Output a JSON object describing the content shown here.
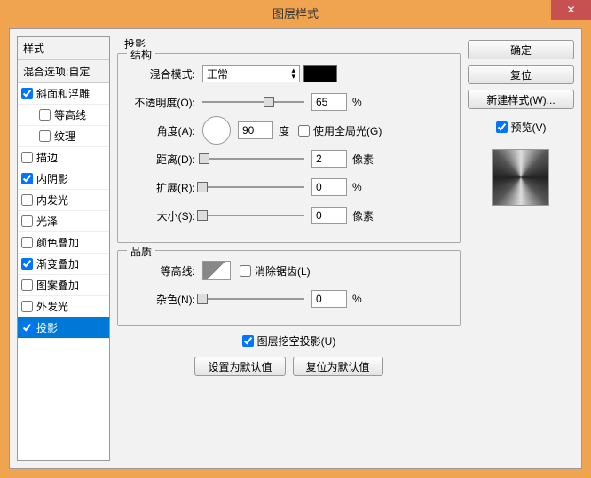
{
  "window": {
    "title": "图层样式"
  },
  "buttons": {
    "ok": "确定",
    "reset": "复位",
    "newStyle": "新建样式(W)...",
    "preview": "预览(V)",
    "setDefault": "设置为默认值",
    "resetDefault": "复位为默认值"
  },
  "left": {
    "header": "样式",
    "subheader": "混合选项:自定",
    "items": [
      {
        "label": "斜面和浮雕",
        "checked": true,
        "indent": false
      },
      {
        "label": "等高线",
        "checked": false,
        "indent": true
      },
      {
        "label": "纹理",
        "checked": false,
        "indent": true
      },
      {
        "label": "描边",
        "checked": false,
        "indent": false
      },
      {
        "label": "内阴影",
        "checked": true,
        "indent": false
      },
      {
        "label": "内发光",
        "checked": false,
        "indent": false
      },
      {
        "label": "光泽",
        "checked": false,
        "indent": false
      },
      {
        "label": "颜色叠加",
        "checked": false,
        "indent": false
      },
      {
        "label": "渐变叠加",
        "checked": true,
        "indent": false
      },
      {
        "label": "图案叠加",
        "checked": false,
        "indent": false
      },
      {
        "label": "外发光",
        "checked": false,
        "indent": false
      },
      {
        "label": "投影",
        "checked": true,
        "indent": false,
        "selected": true
      }
    ]
  },
  "mid": {
    "title": "投影",
    "structure": {
      "legend": "结构",
      "blendMode": {
        "label": "混合模式:",
        "value": "正常"
      },
      "color": "#000000",
      "opacity": {
        "label": "不透明度(O):",
        "value": "65",
        "unit": "%",
        "pos": 65
      },
      "angle": {
        "label": "角度(A):",
        "value": "90",
        "unit": "度",
        "rotate": 0
      },
      "globalLight": {
        "label": "使用全局光(G)",
        "checked": false
      },
      "distance": {
        "label": "距离(D):",
        "value": "2",
        "unit": "像素",
        "pos": 2
      },
      "spread": {
        "label": "扩展(R):",
        "value": "0",
        "unit": "%",
        "pos": 0
      },
      "size": {
        "label": "大小(S):",
        "value": "0",
        "unit": "像素",
        "pos": 0
      }
    },
    "quality": {
      "legend": "品质",
      "contour": {
        "label": "等高线:"
      },
      "antiAlias": {
        "label": "消除锯齿(L)",
        "checked": false
      },
      "noise": {
        "label": "杂色(N):",
        "value": "0",
        "unit": "%",
        "pos": 0
      }
    },
    "knockout": {
      "label": "图层挖空投影(U)",
      "checked": true
    }
  }
}
